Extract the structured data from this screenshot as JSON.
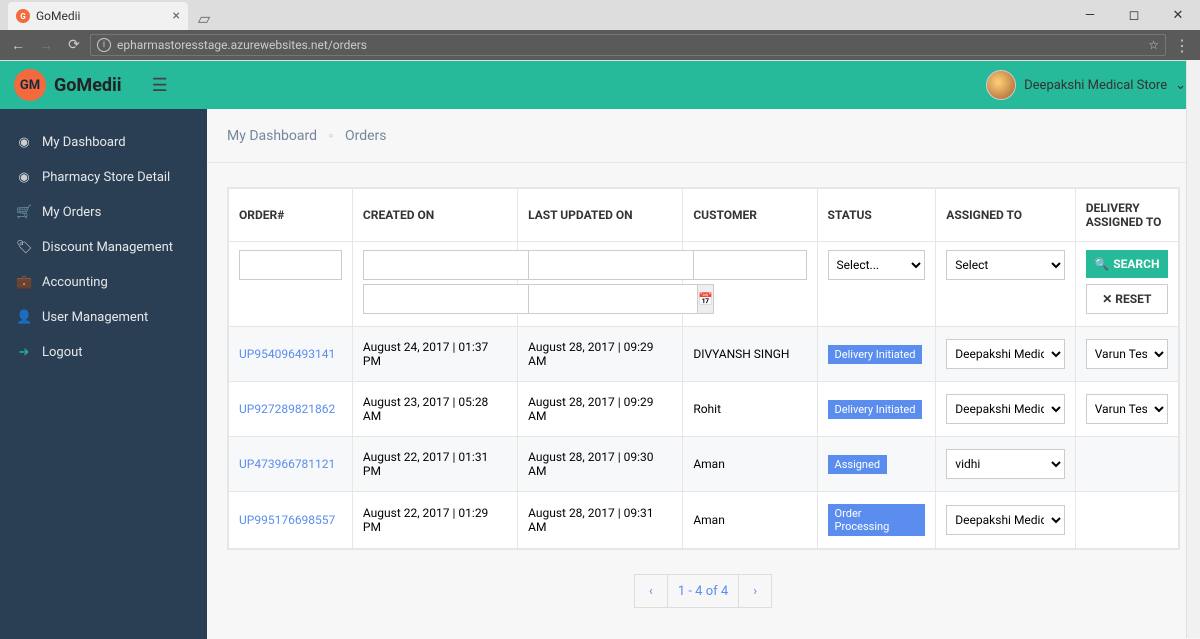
{
  "browser": {
    "tab_title": "GoMedii",
    "url": "epharmastoresstage.azurewebsites.net/orders"
  },
  "header": {
    "logo_badge": "GM",
    "logo_text": "GoMedii",
    "user_store": "Deepakshi Medical Store"
  },
  "sidebar": {
    "items": [
      {
        "label": "My Dashboard",
        "icon": "◉"
      },
      {
        "label": "Pharmacy Store Detail",
        "icon": "◉"
      },
      {
        "label": "My Orders",
        "icon": "🛒"
      },
      {
        "label": "Discount Management",
        "icon": "🏷"
      },
      {
        "label": "Accounting",
        "icon": "💼"
      },
      {
        "label": "User Management",
        "icon": "👤"
      },
      {
        "label": "Logout",
        "icon": "➜"
      }
    ]
  },
  "breadcrumb": {
    "root": "My Dashboard",
    "current": "Orders"
  },
  "table": {
    "headers": {
      "order": "ORDER#",
      "created": "CREATED ON",
      "updated": "LAST UPDATED ON",
      "customer": "CUSTOMER",
      "status": "STATUS",
      "assigned": "ASSIGNED TO",
      "delivery": "DELIVERY ASSIGNED TO"
    },
    "filters": {
      "status_placeholder": "Select...",
      "assigned_placeholder": "Select",
      "search_label": "SEARCH",
      "reset_label": "RESET"
    },
    "assigned_options": [
      "Deepakshi Medical Sto",
      "vidhi"
    ],
    "delivery_options": [
      "Varun Test"
    ],
    "rows": [
      {
        "order": "UP954096493141",
        "created": "August 24, 2017 | 01:37 PM",
        "updated": "August 28, 2017 | 09:29 AM",
        "customer": "DIVYANSH SINGH",
        "status": "Delivery Initiated",
        "assigned": "Deepakshi Medical Sto",
        "delivery": "Varun Test"
      },
      {
        "order": "UP927289821862",
        "created": "August 23, 2017 | 05:28 AM",
        "updated": "August 28, 2017 | 09:29 AM",
        "customer": "Rohit",
        "status": "Delivery Initiated",
        "assigned": "Deepakshi Medical Sto",
        "delivery": "Varun Test"
      },
      {
        "order": "UP473966781121",
        "created": "August 22, 2017 | 01:31 PM",
        "updated": "August 28, 2017 | 09:30 AM",
        "customer": "Aman",
        "status": "Assigned",
        "assigned": "vidhi",
        "delivery": ""
      },
      {
        "order": "UP995176698557",
        "created": "August 22, 2017 | 01:29 PM",
        "updated": "August 28, 2017 | 09:31 AM",
        "customer": "Aman",
        "status": "Order Processing",
        "assigned": "Deepakshi Medical Sto",
        "delivery": ""
      }
    ]
  },
  "pagination": {
    "text": "1 - 4 of 4"
  }
}
